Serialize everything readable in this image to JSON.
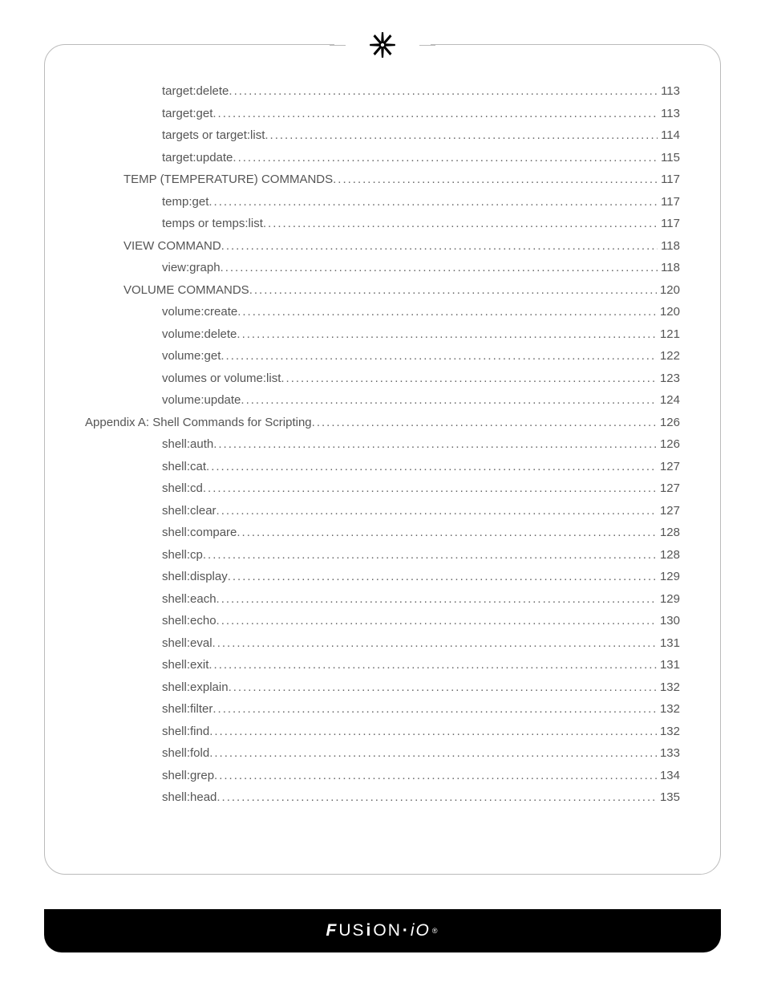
{
  "brand": "FUSiON-iO",
  "toc": [
    {
      "level": 2,
      "label": "target:delete",
      "page": "113"
    },
    {
      "level": 2,
      "label": "target:get",
      "page": "113"
    },
    {
      "level": 2,
      "label": "targets or target:list",
      "page": "114"
    },
    {
      "level": 2,
      "label": "target:update",
      "page": "115"
    },
    {
      "level": 1,
      "label": "TEMP (TEMPERATURE) COMMANDS",
      "page": "117"
    },
    {
      "level": 2,
      "label": "temp:get",
      "page": "117"
    },
    {
      "level": 2,
      "label": "temps or temps:list",
      "page": "117"
    },
    {
      "level": 1,
      "label": "VIEW COMMAND",
      "page": "118"
    },
    {
      "level": 2,
      "label": "view:graph",
      "page": "118"
    },
    {
      "level": 1,
      "label": "VOLUME COMMANDS",
      "page": "120"
    },
    {
      "level": 2,
      "label": "volume:create",
      "page": "120"
    },
    {
      "level": 2,
      "label": "volume:delete",
      "page": "121"
    },
    {
      "level": 2,
      "label": "volume:get",
      "page": "122"
    },
    {
      "level": 2,
      "label": "volumes or volume:list",
      "page": "123"
    },
    {
      "level": 2,
      "label": "volume:update",
      "page": "124"
    },
    {
      "level": 0,
      "label": "Appendix A: Shell Commands for Scripting",
      "page": "126"
    },
    {
      "level": 2,
      "label": "shell:auth",
      "page": "126"
    },
    {
      "level": 2,
      "label": "shell:cat",
      "page": "127"
    },
    {
      "level": 2,
      "label": "shell:cd",
      "page": "127"
    },
    {
      "level": 2,
      "label": "shell:clear",
      "page": "127"
    },
    {
      "level": 2,
      "label": "shell:compare",
      "page": "128"
    },
    {
      "level": 2,
      "label": "shell:cp",
      "page": "128"
    },
    {
      "level": 2,
      "label": "shell:display",
      "page": "129"
    },
    {
      "level": 2,
      "label": "shell:each",
      "page": "129"
    },
    {
      "level": 2,
      "label": "shell:echo",
      "page": "130"
    },
    {
      "level": 2,
      "label": "shell:eval",
      "page": "131"
    },
    {
      "level": 2,
      "label": "shell:exit",
      "page": "131"
    },
    {
      "level": 2,
      "label": "shell:explain",
      "page": "132"
    },
    {
      "level": 2,
      "label": "shell:filter",
      "page": "132"
    },
    {
      "level": 2,
      "label": "shell:find",
      "page": "132"
    },
    {
      "level": 2,
      "label": "shell:fold",
      "page": "133"
    },
    {
      "level": 2,
      "label": "shell:grep",
      "page": "134"
    },
    {
      "level": 2,
      "label": "shell:head",
      "page": "135"
    }
  ]
}
